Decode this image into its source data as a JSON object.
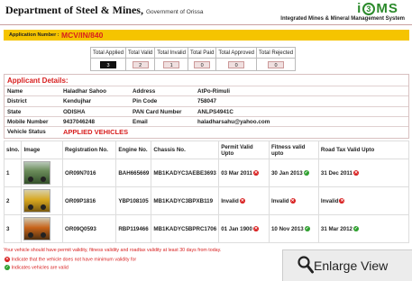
{
  "header": {
    "dept": "Department of Steel & Mines,",
    "gov": "Government of Orissa",
    "logo_left": "i",
    "logo_three": "3",
    "logo_right": "MS",
    "subtitle": "Integrated Mines & Mineral Management System"
  },
  "application": {
    "label": "Application Number :",
    "value": "MCV/IN/840"
  },
  "summary": {
    "headers": [
      "Total Applied",
      "Total Valid",
      "Total Invalid",
      "Total Paid",
      "Total Approved",
      "Total Rejected"
    ],
    "values": [
      "3",
      "2",
      "1",
      "0",
      "0",
      "0"
    ]
  },
  "applicant": {
    "title": "Applicant Details:",
    "rows": [
      [
        "Name",
        "Haladhar Sahoo",
        "Address",
        "AtPo-Rimuli"
      ],
      [
        "District",
        "Kendujhar",
        "Pin Code",
        "758047"
      ],
      [
        "State",
        "ODISHA",
        "PAN Card Number",
        "ANLPS4941C"
      ],
      [
        "Mobile Number",
        "9437046248",
        "Email",
        "haladharsahu@yahoo.com"
      ]
    ],
    "vehicle_status_label": "Vehicle  Status",
    "vehicle_status_value": "APPLIED VEHICLES"
  },
  "vehicles": {
    "headers": [
      "slno.",
      "Image",
      "Registration No.",
      "Engine No.",
      "Chassis No.",
      "Permit Valid Upto",
      "Fitness valid upto",
      "Road Tax Valid Upto"
    ],
    "rows": [
      {
        "slno": "1",
        "reg": "OR09N7016",
        "engine": "BAH665669",
        "chassis": "MB1KADYC3AEBE3693",
        "permit": "03 Mar 2011",
        "permit_ok": false,
        "fitness": "30 Jan 2013",
        "fitness_ok": true,
        "roadtax": "31 Dec 2011",
        "roadtax_ok": false,
        "img": "green"
      },
      {
        "slno": "2",
        "reg": "OR09P1816",
        "engine": "YBP108105",
        "chassis": "MB1KADYC3BPXB119",
        "permit": "Invalid",
        "permit_ok": false,
        "fitness": "Invalid",
        "fitness_ok": false,
        "roadtax": "Invalid",
        "roadtax_ok": false,
        "img": "yellow"
      },
      {
        "slno": "3",
        "reg": "OR09Q0593",
        "engine": "RBP119466",
        "chassis": "MB1KADYC5BPRC1706",
        "permit": "01 Jan 1900",
        "permit_ok": false,
        "fitness": "10 Nov 2013",
        "fitness_ok": true,
        "roadtax": "31 Mar 2012",
        "roadtax_ok": true,
        "img": "orange"
      }
    ]
  },
  "footer": {
    "note": "Your vehicle should have  permit validity, fitness validity and roadtax validity at least 30 days from today.",
    "legend_invalid": "Indicate that the vehicle does not have minimum validity for",
    "legend_valid": "Indicates vehicles are valid"
  },
  "enlarge": {
    "label": "Enlarge View",
    "icon": "magnifier-icon"
  },
  "colors": {
    "accent_red": "#d81e1e",
    "app_bar": "#f5c400",
    "logo_green": "#2b8a2b"
  }
}
